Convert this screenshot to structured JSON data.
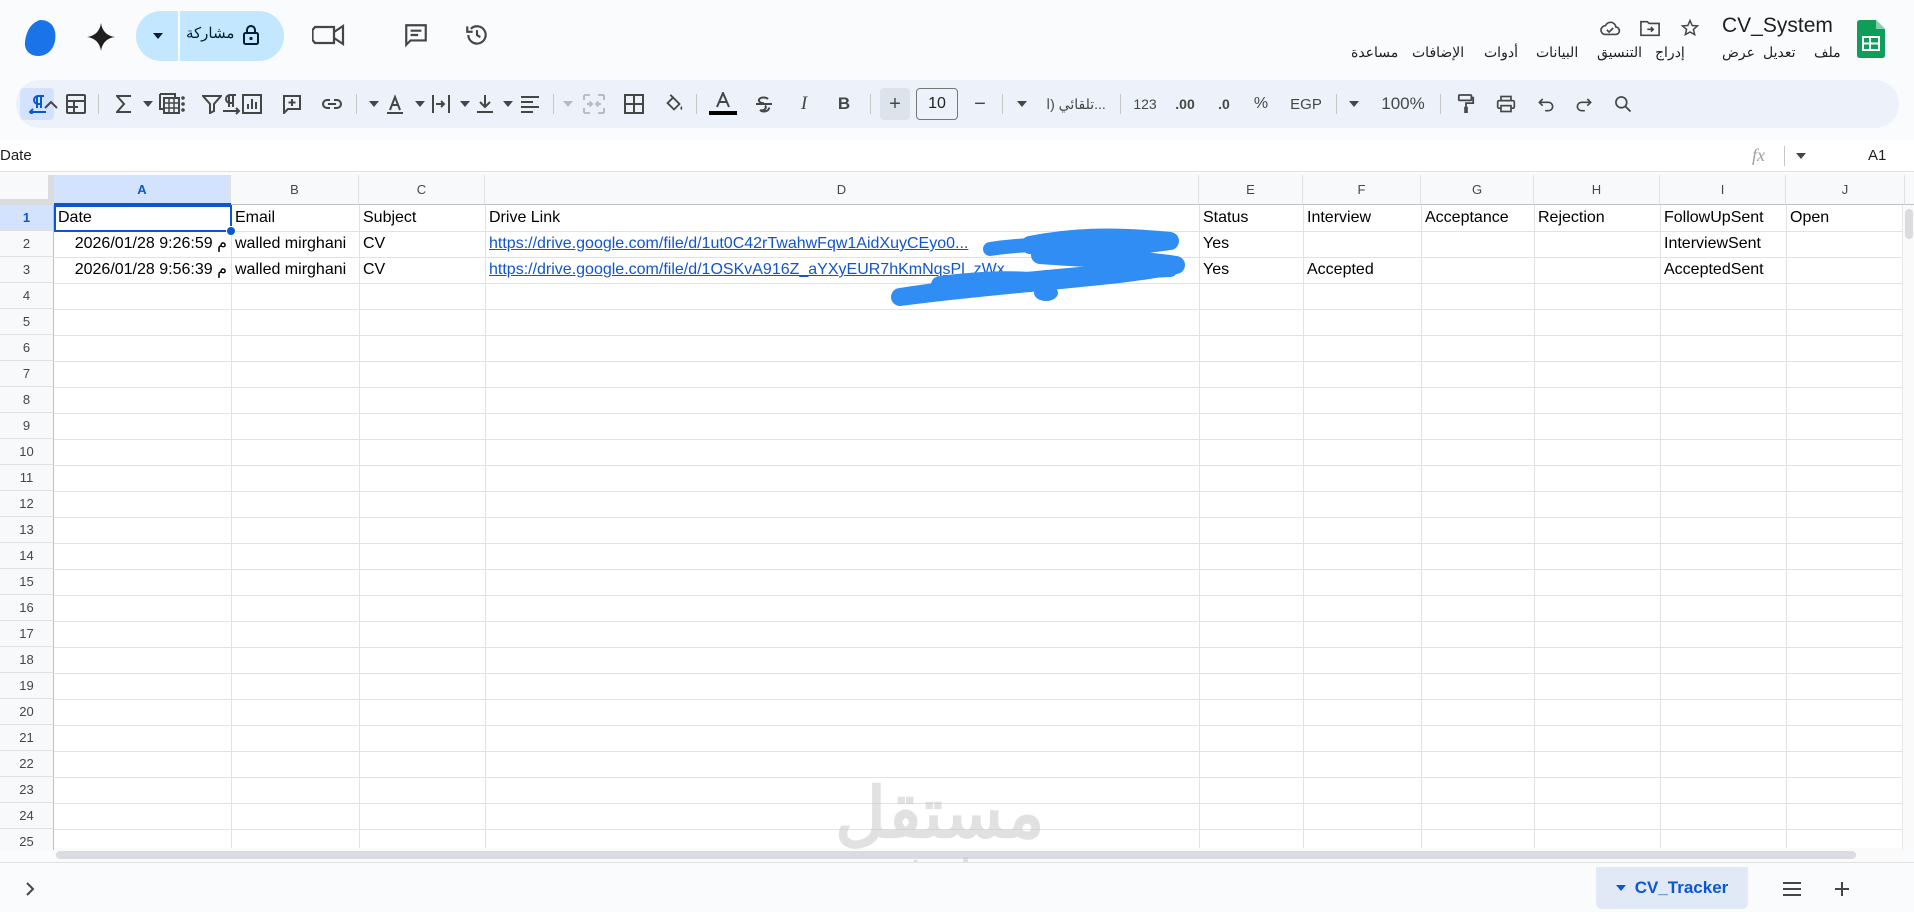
{
  "header": {
    "doc_title": "CV_System",
    "share_label": "مشاركة",
    "menu": [
      "ملف",
      "تعديل",
      "عرض",
      "إدراج",
      "التنسيق",
      "البيانات",
      "أدوات",
      "الإضافات",
      "مساعدة"
    ]
  },
  "toolbar": {
    "zoom": "100%",
    "currency": "EGP",
    "percent": "%",
    "decrease_decimal": ".0",
    "increase_decimal": ".00",
    "number_format": "123",
    "font_name": "تلقائي (ا...",
    "font_size": "10",
    "minus": "−",
    "plus": "+",
    "bold": "B",
    "italic": "I"
  },
  "formula_bar": {
    "name_box": "A1",
    "fx": "fx",
    "content": "Date"
  },
  "columns": [
    "A",
    "B",
    "C",
    "D",
    "E",
    "F",
    "G",
    "H",
    "I",
    "J"
  ],
  "rows": [
    "1",
    "2",
    "3",
    "4",
    "5",
    "6",
    "7",
    "8",
    "9",
    "10",
    "11",
    "12",
    "13",
    "14",
    "15",
    "16",
    "17",
    "18",
    "19",
    "20",
    "21",
    "22",
    "23",
    "24",
    "25"
  ],
  "sheet": {
    "headers": [
      "Date",
      "Email",
      "Subject",
      "Drive Link",
      "Status",
      "Interview",
      "Acceptance",
      "Rejection",
      "FollowUpSent",
      "Open"
    ],
    "row2": {
      "date": "م 9:26:59 2026/01/28",
      "email": "walled mirghani",
      "subject": "CV",
      "link": "https://drive.google.com/file/d/1ut0C42rTwahwFqw1AidXuyCEyo0...",
      "status": "Yes",
      "interview": "",
      "followup": "InterviewSent"
    },
    "row3": {
      "date": "م 9:56:39 2026/01/28",
      "email": "walled mirghani",
      "subject": "CV",
      "link": "https://drive.google.com/file/d/1OSKvA916Z_aYXyEUR7hKmNqsPl_zWx",
      "status": "Yes",
      "interview": "Accepted",
      "followup": "AcceptedSent"
    }
  },
  "bottom": {
    "active_sheet": "CV_Tracker"
  },
  "watermark": {
    "ar": "مستقل",
    "en": "mostaql.com"
  },
  "colors": {
    "accent": "#0b57d0",
    "sheets_green": "#0f9d58",
    "share_bg": "#c2e7ff",
    "link": "#1155cc",
    "redaction": "#2f8df3"
  }
}
